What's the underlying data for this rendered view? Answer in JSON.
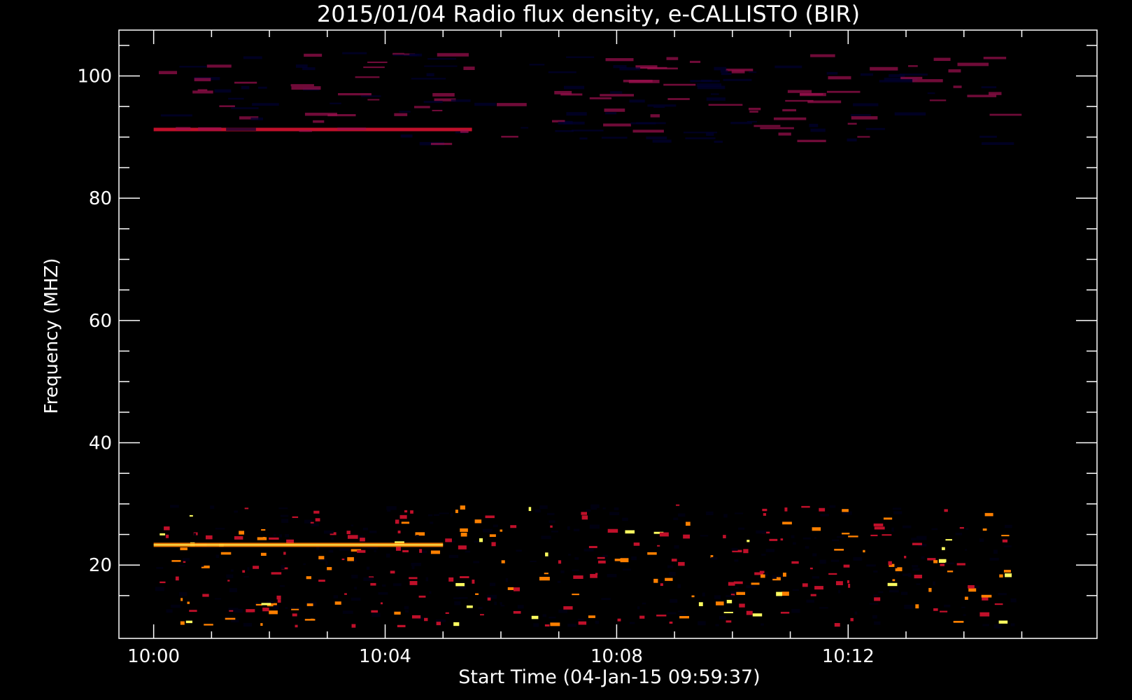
{
  "chart_data": {
    "type": "heatmap",
    "title": "2015/01/04  Radio flux density, e-CALLISTO (BIR)",
    "xlabel": "Start Time (04-Jan-15 09:59:37)",
    "ylabel": "Frequency (MHZ)",
    "xlim_minutes_after_1000": [
      -0.6,
      16.3
    ],
    "ylim_mhz": [
      107.5,
      8.0
    ],
    "x_ticks": [
      {
        "minutes_after_1000": 0,
        "label": "10:00"
      },
      {
        "minutes_after_1000": 4,
        "label": "10:04"
      },
      {
        "minutes_after_1000": 8,
        "label": "10:08"
      },
      {
        "minutes_after_1000": 12,
        "label": "10:12"
      }
    ],
    "x_minor_tick_interval_minutes": 1,
    "y_ticks": [
      {
        "mhz": 20,
        "label": "20"
      },
      {
        "mhz": 40,
        "label": "40"
      },
      {
        "mhz": 60,
        "label": "60"
      },
      {
        "mhz": 80,
        "label": "80"
      },
      {
        "mhz": 100,
        "label": "100"
      }
    ],
    "y_minor_tick_interval_mhz": 5,
    "data_extent": {
      "time_minutes": [
        0,
        15
      ],
      "mhz": [
        10.2,
        106
      ]
    },
    "background_level": "low",
    "bands": [
      {
        "mhz_from": 10.2,
        "mhz_to": 29.5,
        "intensity": "high"
      },
      {
        "mhz": 23.3,
        "time_minutes": [
          0,
          5
        ],
        "intensity": "very high"
      },
      {
        "mhz": 91.3,
        "time_minutes": [
          0,
          5.5
        ],
        "intensity": "high"
      },
      {
        "mhz_from": 89,
        "mhz_to": 104,
        "intensity": "medium"
      }
    ],
    "colors": {
      "background": "#000000",
      "low": "#1a1aff",
      "mid": "#c0102a",
      "high": "#ff8000",
      "max": "#ffff60"
    },
    "grid": false,
    "legend": "none"
  }
}
